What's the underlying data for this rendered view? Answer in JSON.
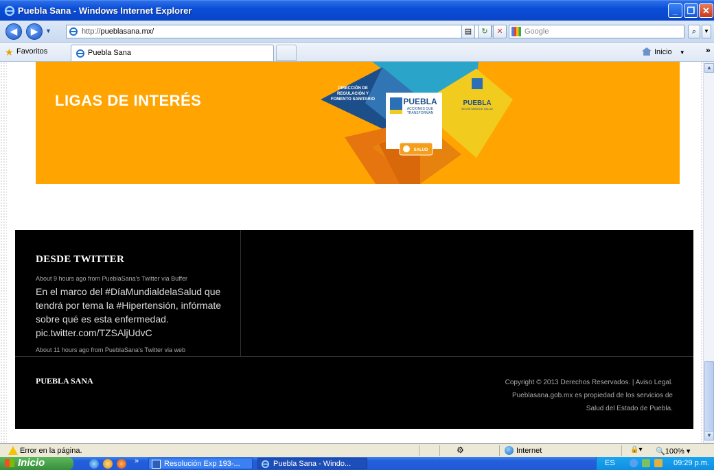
{
  "window": {
    "title": "Puebla Sana - Windows Internet Explorer",
    "minimize": "_",
    "maximize": "❐",
    "close": "✕"
  },
  "addressbar": {
    "back": "◀",
    "forward": "▶",
    "url_prefix": "http://",
    "url_host": "pueblasana.mx/",
    "search_placeholder": "Google",
    "search_go": "⌕"
  },
  "favorites": {
    "label": "Favoritos",
    "tab_label": "Puebla Sana",
    "home_label": "Inicio",
    "more": "»"
  },
  "page": {
    "banner_title": "LIGAS DE INTERÉS",
    "logo": {
      "dir_text": [
        "DIRECCIÓN DE",
        "REGULACIÓN Y",
        "FOMENTO SANITARIO"
      ],
      "center_title": "PUEBLA",
      "center_sub": [
        "ACCIONES QUE",
        "TRANSFORMAN"
      ],
      "right_title": "PUEBLA",
      "right_sub": "SECRETARÍA DE SALUD",
      "bottom_label": "SALUD"
    },
    "twitter_heading": "DESDE TWITTER",
    "tweet_meta_1": "About 9 hours ago from PueblaSana's Twitter via Buffer",
    "tweet_text": "En el marco del #DíaMundialdelaSalud que tendrá por tema la #Hipertensión, infórmate sobre qué es esta enfermedad. pic.twitter.com/TZSAljUdvC",
    "tweet_meta_2": "About 11 hours ago from PueblaSana's Twitter via web",
    "footer_title": "PUEBLA SANA",
    "copyright_lines": [
      "Copyright © 2013 Derechos Reservados. | Aviso Legal.",
      "Pueblasana.gob.mx es propiedad de los servicios de",
      "Salud del Estado de Puebla."
    ]
  },
  "statusbar": {
    "message": "Error en la página.",
    "zone": "Internet",
    "zoom": "100%"
  },
  "taskbar": {
    "start": "Inicio",
    "items": [
      "Resolución Exp 193-...",
      "Puebla Sana - Windo..."
    ],
    "lang": "ES",
    "clock": "09:29 p.m."
  },
  "colors": {
    "banner": "#ffa400",
    "footer": "#000000",
    "titlebar": "#0a4ed8"
  }
}
